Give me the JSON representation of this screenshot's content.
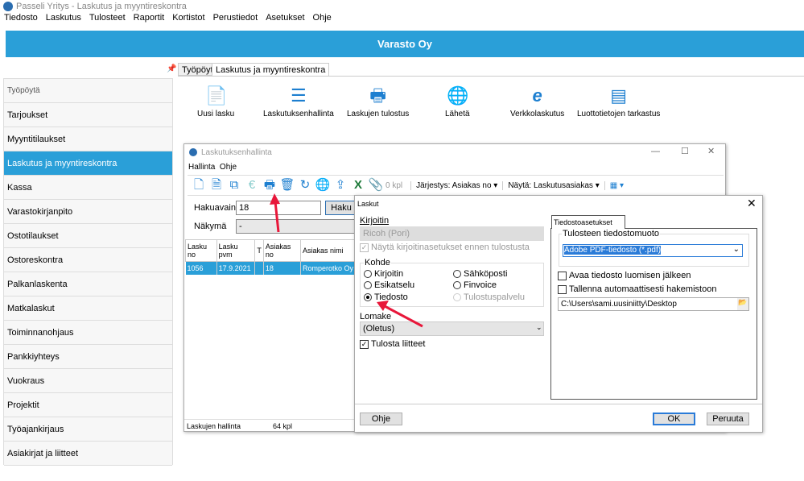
{
  "window_title": "Passeli Yritys - Laskutus ja myyntireskontra",
  "menu": [
    "Tiedosto",
    "Laskutus",
    "Tulosteet",
    "Raportit",
    "Kortistot",
    "Perustiedot",
    "Asetukset",
    "Ohje"
  ],
  "banner": "Varasto Oy",
  "sidebar": {
    "items": [
      "Työpöytä",
      "Tarjoukset",
      "Myyntitilaukset",
      "Laskutus ja myyntireskontra",
      "Kassa",
      "Varastokirjanpito",
      "Ostotilaukset",
      "Ostoreskontra",
      "Palkanlaskenta",
      "Matkalaskut",
      "Toiminnanohjaus",
      "Pankkiyhteys",
      "Vuokraus",
      "Projektit",
      "Työajankirjaus",
      "Asiakirjat ja liitteet"
    ],
    "selected": "Laskutus ja myyntireskontra"
  },
  "tabs": [
    "Työpöytä",
    "Laskutus ja myyntireskontra"
  ],
  "actions": [
    "Uusi lasku",
    "Laskutuksenhallinta",
    "Laskujen tulostus",
    "Lähetä",
    "Verkkolaskutus",
    "Luottotietojen tarkastus"
  ],
  "manager": {
    "title": "Laskutuksenhallinta",
    "menu": [
      "Hallinta",
      "Ohje"
    ],
    "attachments": "0 kpl",
    "sort": "Järjestys: Asiakas no",
    "view": "Näytä: Laskutusasiakas",
    "search_label": "Hakuavain",
    "search_value": "18",
    "search_button": "Haku",
    "view_label": "Näkymä",
    "view_value": "-",
    "columns": [
      "Lasku no",
      "Lasku pvm",
      "T",
      "Asiakas no",
      "Asiakas nimi"
    ],
    "rows": [
      [
        "1056",
        "17.9.2021",
        "",
        "18",
        "Romperotko Oy"
      ]
    ],
    "status_left": "Laskujen hallinta",
    "status_count": "64 kpl"
  },
  "dialog": {
    "title": "Laskut",
    "printer_label": "Kirjoitin",
    "printer_value": "Ricoh (Pori)",
    "show_printer_settings": "Näytä kirjoitinasetukset ennen tulostusta",
    "target_label": "Kohde",
    "targets": [
      "Kirjoitin",
      "Sähköposti",
      "Esikatselu",
      "Finvoice",
      "Tiedosto",
      "Tulostuspalvelu"
    ],
    "selected_target": "Tiedosto",
    "form_label": "Lomake",
    "form_value": "(Oletus)",
    "print_attachments": "Tulosta liitteet",
    "file_tab": "Tiedostoasetukset",
    "format_label": "Tulosteen tiedostomuoto",
    "format_value": "Adobe PDF-tiedosto (*.pdf)",
    "open_after": "Avaa tiedosto luomisen jälkeen",
    "auto_save": "Tallenna automaattisesti hakemistoon",
    "path": "C:\\Users\\sami.uusiniitty\\Desktop",
    "help": "Ohje",
    "ok": "OK",
    "cancel": "Peruuta"
  },
  "colors": {
    "accent": "#2a9fd8",
    "arrow": "#e8173a"
  }
}
